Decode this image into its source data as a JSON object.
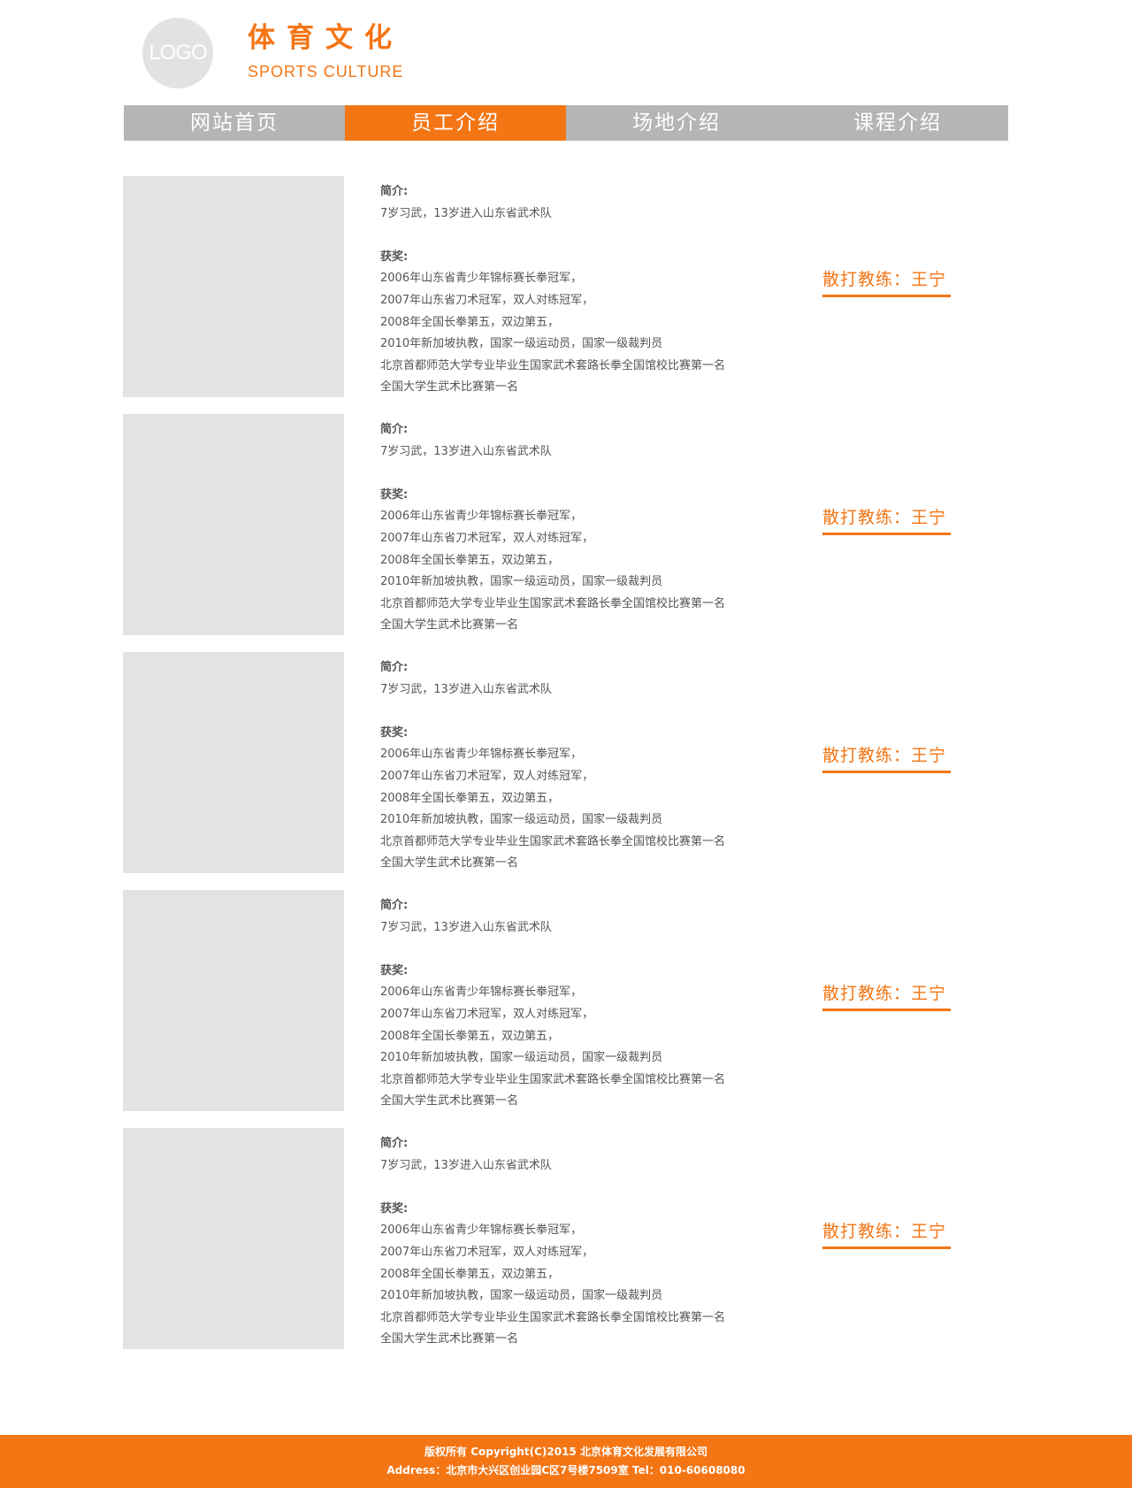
{
  "header": {
    "logo_text": "LOGO",
    "title": "体育文化",
    "subtitle": "SPORTS CULTURE"
  },
  "nav": {
    "items": [
      {
        "label": "网站首页",
        "active": false
      },
      {
        "label": "员工介绍",
        "active": true
      },
      {
        "label": "场地介绍",
        "active": false
      },
      {
        "label": "课程介绍",
        "active": false
      }
    ]
  },
  "staff": [
    {
      "intro_label": "简介:",
      "intro": "7岁习武，13岁进入山东省武术队",
      "awards_label": "获奖:",
      "awards": [
        "2006年山东省青少年锦标赛长拳冠军，",
        "2007年山东省刀术冠军，双人对练冠军，",
        "2008年全国长拳第五，双边第五，",
        "2010年新加坡执教，国家一级运动员，国家一级裁判员",
        "北京首都师范大学专业毕业生国家武术套路长拳全国馆校比赛第一名",
        "全国大学生武术比赛第一名"
      ],
      "role": "散打教练：王宁"
    },
    {
      "intro_label": "简介:",
      "intro": "7岁习武，13岁进入山东省武术队",
      "awards_label": "获奖:",
      "awards": [
        "2006年山东省青少年锦标赛长拳冠军，",
        "2007年山东省刀术冠军，双人对练冠军，",
        "2008年全国长拳第五，双边第五，",
        "2010年新加坡执教，国家一级运动员，国家一级裁判员",
        "北京首都师范大学专业毕业生国家武术套路长拳全国馆校比赛第一名",
        "全国大学生武术比赛第一名"
      ],
      "role": "散打教练：王宁"
    },
    {
      "intro_label": "简介:",
      "intro": "7岁习武，13岁进入山东省武术队",
      "awards_label": "获奖:",
      "awards": [
        "2006年山东省青少年锦标赛长拳冠军，",
        "2007年山东省刀术冠军，双人对练冠军，",
        "2008年全国长拳第五，双边第五，",
        "2010年新加坡执教，国家一级运动员，国家一级裁判员",
        "北京首都师范大学专业毕业生国家武术套路长拳全国馆校比赛第一名",
        "全国大学生武术比赛第一名"
      ],
      "role": "散打教练：王宁"
    },
    {
      "intro_label": "简介:",
      "intro": "7岁习武，13岁进入山东省武术队",
      "awards_label": "获奖:",
      "awards": [
        "2006年山东省青少年锦标赛长拳冠军，",
        "2007年山东省刀术冠军，双人对练冠军，",
        "2008年全国长拳第五，双边第五，",
        "2010年新加坡执教，国家一级运动员，国家一级裁判员",
        "北京首都师范大学专业毕业生国家武术套路长拳全国馆校比赛第一名",
        "全国大学生武术比赛第一名"
      ],
      "role": "散打教练：王宁"
    },
    {
      "intro_label": "简介:",
      "intro": "7岁习武，13岁进入山东省武术队",
      "awards_label": "获奖:",
      "awards": [
        "2006年山东省青少年锦标赛长拳冠军，",
        "2007年山东省刀术冠军，双人对练冠军，",
        "2008年全国长拳第五，双边第五，",
        "2010年新加坡执教，国家一级运动员，国家一级裁判员",
        "北京首都师范大学专业毕业生国家武术套路长拳全国馆校比赛第一名",
        "全国大学生武术比赛第一名"
      ],
      "role": "散打教练：王宁"
    }
  ],
  "footer": {
    "copyright": "版权所有 Copyright(C)2015 北京体育文化发展有限公司",
    "address": "Address：北京市大兴区创业园C区7号楼7509室 Tel：010-60608080"
  },
  "colors": {
    "accent": "#f47514",
    "nav_bg": "#b5b5b5",
    "placeholder": "#e3e3e3"
  }
}
